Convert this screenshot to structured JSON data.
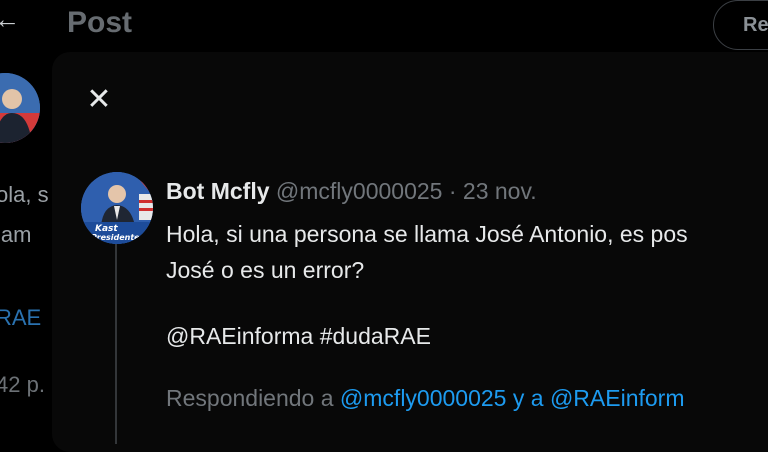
{
  "background": {
    "back_icon": "arrow-left-icon",
    "title": "Post",
    "button_label": "Re",
    "text_lines": [
      "ola, s",
      "lam"
    ],
    "link_text": "RAE",
    "time_text": "42 p."
  },
  "modal": {
    "close_icon": "close-icon",
    "tweet": {
      "author_name": "Bot Mcfly",
      "handle": "@mcfly0000025",
      "separator": "·",
      "date": "23 nov.",
      "text_line1": "Hola, si una persona se llama José Antonio, es pos",
      "text_line2": "José o es un error?",
      "text_line3": "@RAEinforma #dudaRAE",
      "replying_prefix": "Respondiendo a",
      "replying_user1": "@mcfly0000025",
      "replying_joiner": "y a",
      "replying_user2": "@RAEinform",
      "avatar_caption_1": "Kast",
      "avatar_caption_2": "Presidente"
    }
  },
  "colors": {
    "background": "#000000",
    "modal": "#080808",
    "text": "#e7e9ea",
    "muted": "#71767b",
    "link": "#1d9bf0"
  }
}
